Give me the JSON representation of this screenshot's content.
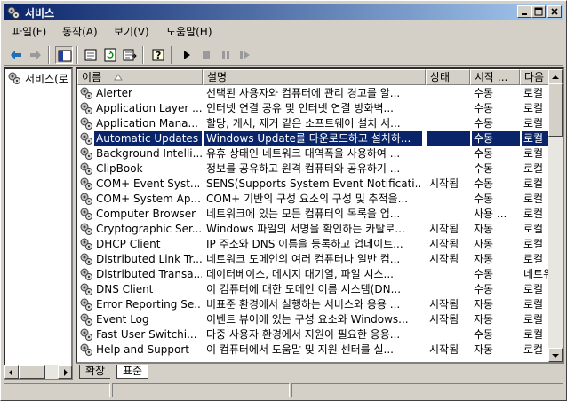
{
  "window": {
    "title": "서비스"
  },
  "menu": [
    "파일(F)",
    "동작(A)",
    "보기(V)",
    "도움말(H)"
  ],
  "toolbar": {
    "icons": [
      "back-arrow-icon",
      "forward-arrow-icon",
      "show-hide-tree-icon",
      "properties-icon",
      "refresh-icon",
      "export-list-icon",
      "help-icon",
      "play-icon",
      "stop-icon",
      "pause-icon",
      "restart-icon"
    ]
  },
  "tree": {
    "root": "서비스(로"
  },
  "columns": [
    "이름",
    "설명",
    "상태",
    "시작 ...",
    "다음"
  ],
  "rows": [
    {
      "name": "Alerter",
      "desc": "선택된 사용자와 컴퓨터에 관리 경고를 알...",
      "status": "",
      "start": "수동",
      "logon": "로컬"
    },
    {
      "name": "Application Layer ...",
      "desc": "인터넷 연결 공유 및 인터넷 연결 방화벽...",
      "status": "",
      "start": "수동",
      "logon": "로컬"
    },
    {
      "name": "Application Mana...",
      "desc": "할당, 게시, 제거 같은 소프트웨어 설치 서...",
      "status": "",
      "start": "수동",
      "logon": "로컬"
    },
    {
      "name": "Automatic Updates",
      "desc": "Windows Update를 다운로드하고 설치하...",
      "status": "",
      "start": "수동",
      "logon": "로컬",
      "selected": true
    },
    {
      "name": "Background Intelli...",
      "desc": "유휴 상태인 네트워크 대역폭을 사용하여 ...",
      "status": "",
      "start": "수동",
      "logon": "로컬"
    },
    {
      "name": "ClipBook",
      "desc": "정보를 공유하고 원격 컴퓨터와 공유하기 ...",
      "status": "",
      "start": "수동",
      "logon": "로컬"
    },
    {
      "name": "COM+ Event Syst...",
      "desc": "SENS(Supports System Event Notificati...",
      "status": "시작됨",
      "start": "수동",
      "logon": "로컬"
    },
    {
      "name": "COM+ System Ap...",
      "desc": "COM+ 기반의 구성 요소의 구성 및 추적을...",
      "status": "",
      "start": "수동",
      "logon": "로컬"
    },
    {
      "name": "Computer Browser",
      "desc": "네트워크에 있는 모든 컴퓨터의 목록을 업...",
      "status": "",
      "start": "사용 ...",
      "logon": "로컬"
    },
    {
      "name": "Cryptographic Ser...",
      "desc": "Windows 파일의 서명을 확인하는 카탈로...",
      "status": "시작됨",
      "start": "자동",
      "logon": "로컬"
    },
    {
      "name": "DHCP Client",
      "desc": "IP 주소와 DNS 이름을 등록하고 업데이트...",
      "status": "시작됨",
      "start": "자동",
      "logon": "로컬"
    },
    {
      "name": "Distributed Link Tr...",
      "desc": "네트워크 도메인의 여러 컴퓨터나 일반 컴...",
      "status": "시작됨",
      "start": "자동",
      "logon": "로컬"
    },
    {
      "name": "Distributed Transa...",
      "desc": "데이터베이스, 메시지 대기열, 파일 시스...",
      "status": "",
      "start": "수동",
      "logon": "네트워"
    },
    {
      "name": "DNS Client",
      "desc": "이 컴퓨터에 대한 도메인 이름 시스템(DN...",
      "status": "",
      "start": "수동",
      "logon": "로컬"
    },
    {
      "name": "Error Reporting Se...",
      "desc": "비표준 환경에서 실행하는 서비스와 응용 ...",
      "status": "시작됨",
      "start": "자동",
      "logon": "로컬"
    },
    {
      "name": "Event Log",
      "desc": "이벤트 뷰어에 있는 구성 요소와 Windows...",
      "status": "시작됨",
      "start": "자동",
      "logon": "로컬"
    },
    {
      "name": "Fast User Switchi...",
      "desc": "다중 사용자 환경에서 지원이 필요한 응용...",
      "status": "",
      "start": "수동",
      "logon": "로컬"
    },
    {
      "name": "Help and Support",
      "desc": "이 컴퓨터에서 도움말 및 지원 센터를 실...",
      "status": "시작됨",
      "start": "자동",
      "logon": "로컬"
    }
  ],
  "tabs": [
    "확장",
    "표준"
  ],
  "colors": {
    "selection": "#0a246a",
    "titlebar_start": "#0a246a",
    "titlebar_end": "#a6caf0",
    "face": "#d4d0c8"
  }
}
